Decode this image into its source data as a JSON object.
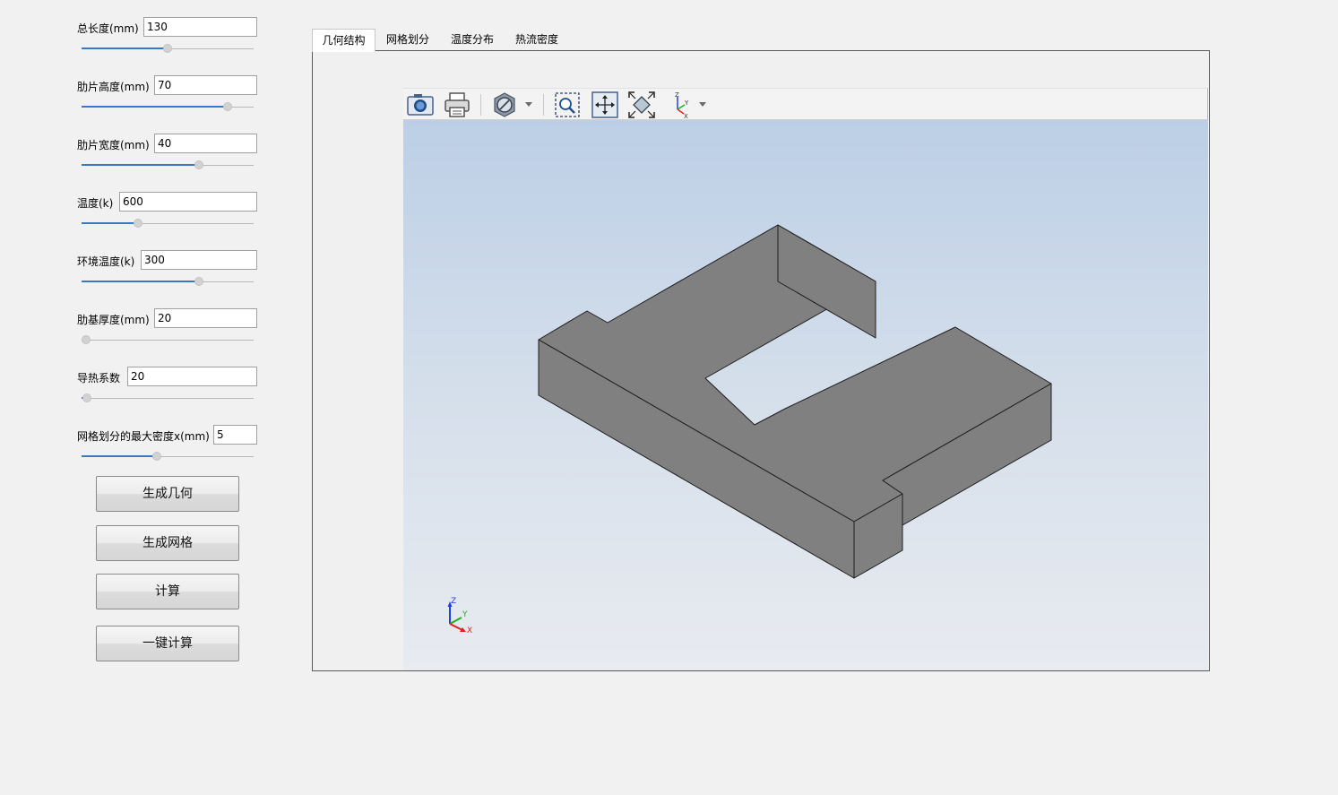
{
  "params": [
    {
      "id": "total-length",
      "label": "总长度(mm)",
      "value": "130",
      "fraction": 0.5
    },
    {
      "id": "fin-height",
      "label": "肋片高度(mm)",
      "value": "70",
      "fraction": 0.85
    },
    {
      "id": "fin-width",
      "label": "肋片宽度(mm)",
      "value": "40",
      "fraction": 0.68
    },
    {
      "id": "temperature",
      "label": "温度(k)",
      "value": "600",
      "fraction": 0.33
    },
    {
      "id": "ambient-temperature",
      "label": "环境温度(k)",
      "value": "300",
      "fraction": 0.68
    },
    {
      "id": "base-thickness",
      "label": "肋基厚度(mm)",
      "value": "20",
      "fraction": 0.0
    },
    {
      "id": "thermal-conductivity",
      "label": "导热系数",
      "value": "20",
      "fraction": 0.03
    },
    {
      "id": "mesh-max-density",
      "label": "网格划分的最大密度x(mm)",
      "value": "5",
      "fraction": 0.44
    }
  ],
  "buttons": {
    "generate_geometry": "生成几何",
    "generate_mesh": "生成网格",
    "compute": "计算",
    "one_click_compute": "一键计算"
  },
  "tabs": [
    {
      "label": "几何结构",
      "active": true
    },
    {
      "label": "网格划分",
      "active": false
    },
    {
      "label": "温度分布",
      "active": false
    },
    {
      "label": "热流密度",
      "active": false
    }
  ],
  "toolbar_icons": [
    "camera-icon",
    "printer-icon",
    "display-mode-icon",
    "zoom-box-icon",
    "pan-icon",
    "fit-view-icon",
    "axes-view-icon"
  ],
  "triad": {
    "x": "X",
    "y": "Y",
    "z": "Z"
  },
  "colors": {
    "slider_fill": "#3b78c4",
    "model_face": "#808080",
    "model_edge": "#1e1e1e",
    "axis_x": "#e02020",
    "axis_y": "#20b020",
    "axis_z": "#2040e0"
  }
}
